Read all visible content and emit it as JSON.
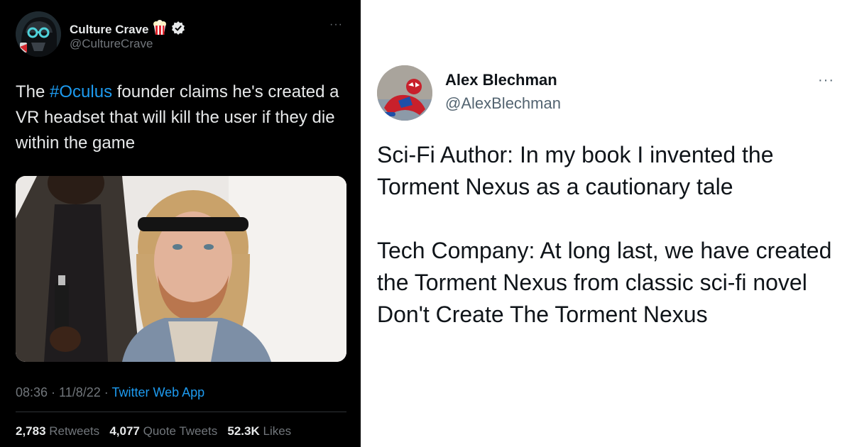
{
  "left_tweet": {
    "author_name": "Culture Crave",
    "author_handle": "@CultureCrave",
    "more_label": "···",
    "text_before": "The ",
    "hashtag": "#Oculus",
    "text_after": " founder claims he's created a VR headset that will kill the user if they die within the game",
    "time": "08:36",
    "date": "11/8/22",
    "source": "Twitter Web App",
    "stats": {
      "retweets_count": "2,783",
      "retweets_label": "Retweets",
      "quotes_count": "4,077",
      "quotes_label": "Quote Tweets",
      "likes_count": "52.3K",
      "likes_label": "Likes"
    },
    "colors": {
      "background": "#000000",
      "link": "#1d9bf0",
      "verified": "#e7e9ea"
    },
    "icons": [
      "avatar-darth-vader",
      "popcorn-emoji-icon",
      "verified-badge-icon",
      "more-icon"
    ]
  },
  "right_tweet": {
    "author_name": "Alex Blechman",
    "author_handle": "@AlexBlechman",
    "more_label": "···",
    "paragraph_1": "Sci-Fi Author: In my book I invented the Torment Nexus as a cautionary tale",
    "paragraph_2": "Tech Company: At long last, we have created the Torment Nexus from classic sci-fi novel Don't Create The Torment Nexus",
    "colors": {
      "background": "#ffffff",
      "text": "#0f1419"
    },
    "icons": [
      "avatar-spiderman",
      "more-icon"
    ]
  }
}
